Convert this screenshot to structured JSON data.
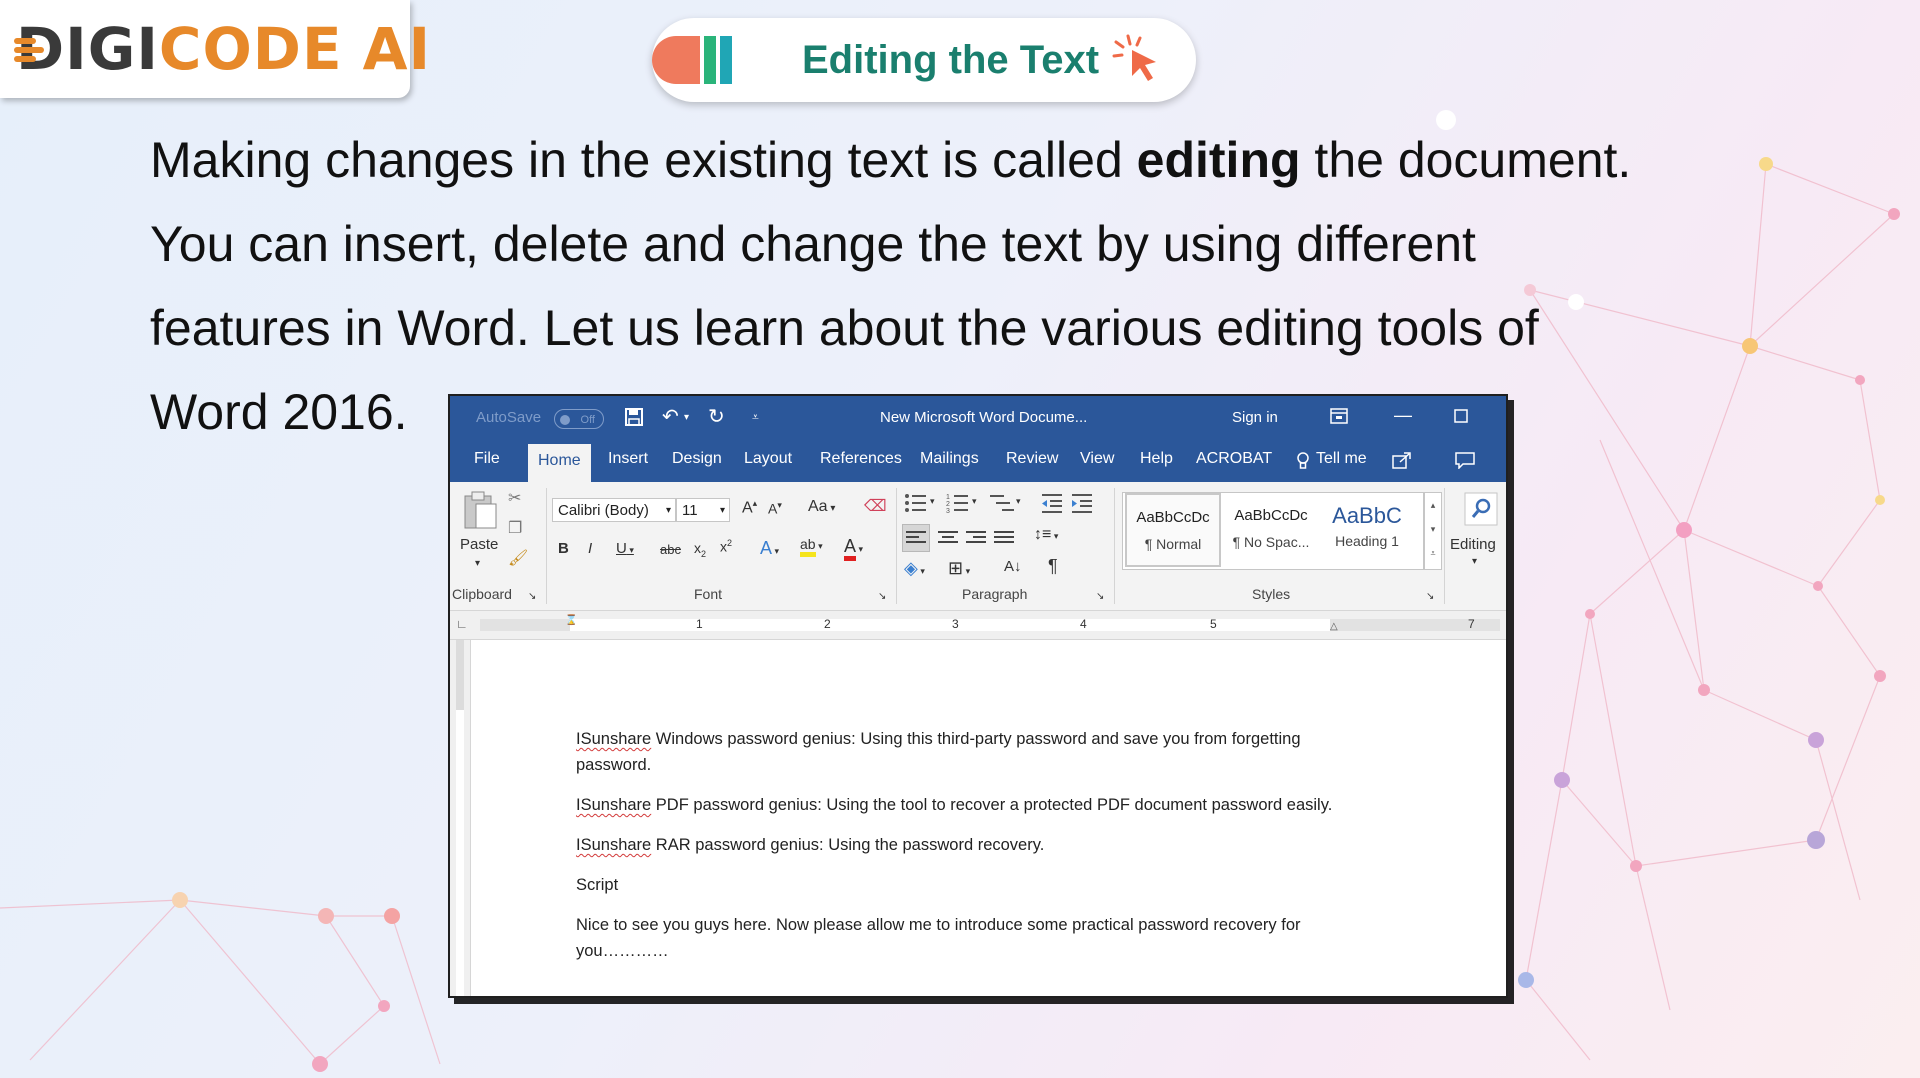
{
  "logo": {
    "part1": "DIGI",
    "part2": "CODE",
    "part3": "AI"
  },
  "slide_title": "Editing the Text",
  "intro": {
    "before_bold": "Making changes in the existing text is called ",
    "bold": "editing",
    "after_bold": " the document. You can insert, delete and change the text by using different features in Word. Let us learn about the various editing tools of Word 2016."
  },
  "word": {
    "titlebar": {
      "autosave": "AutoSave",
      "toggle": "Off",
      "doc_title": "New Microsoft Word Docume...",
      "sign_in": "Sign in"
    },
    "tabs": [
      "File",
      "Home",
      "Insert",
      "Design",
      "Layout",
      "References",
      "Mailings",
      "Review",
      "View",
      "Help",
      "ACROBAT"
    ],
    "tell_me": "Tell me",
    "ribbon": {
      "paste": "Paste",
      "font_name": "Calibri (Body)",
      "font_size": "11",
      "change_case": "Aa",
      "groups": {
        "clipboard": "Clipboard",
        "font": "Font",
        "paragraph": "Paragraph",
        "styles": "Styles"
      },
      "styles": [
        {
          "sample": "AaBbCcDc",
          "name": "¶ Normal"
        },
        {
          "sample": "AaBbCcDc",
          "name": "¶ No Spac..."
        },
        {
          "sample": "AaBbC",
          "name": "Heading 1"
        }
      ],
      "editing": "Editing"
    },
    "ruler_numbers": [
      "1",
      "2",
      "3",
      "4",
      "5",
      "7"
    ],
    "document": {
      "paragraphs": [
        {
          "marked": "ISunshare",
          "rest": " Windows password genius: Using this third-party password and save you from forgetting password."
        },
        {
          "marked": "ISunshare",
          "rest": " PDF password genius: Using the tool to recover a protected PDF document password easily."
        },
        {
          "marked": "ISunshare",
          "rest": " RAR password genius: Using the password recovery."
        },
        {
          "marked": "",
          "rest": "Script"
        },
        {
          "marked": "",
          "rest": "Nice to see you guys here. Now please allow me to introduce some practical password recovery for you…………"
        }
      ]
    }
  },
  "colors": {
    "word_blue": "#2b579a",
    "logo_orange": "#e7892a",
    "title_green": "#1a7f6e",
    "bar_red": "#ef7a5d",
    "bar_green": "#2ab47a",
    "bar_teal": "#20a6b5"
  },
  "icons": [
    "save-icon",
    "undo-icon",
    "redo-icon",
    "cut-icon",
    "copy-icon",
    "format-painter-icon",
    "bullets-icon",
    "numbering-icon",
    "search-icon",
    "share-icon",
    "comment-icon",
    "lightbulb-icon",
    "cursor-click-icon"
  ]
}
